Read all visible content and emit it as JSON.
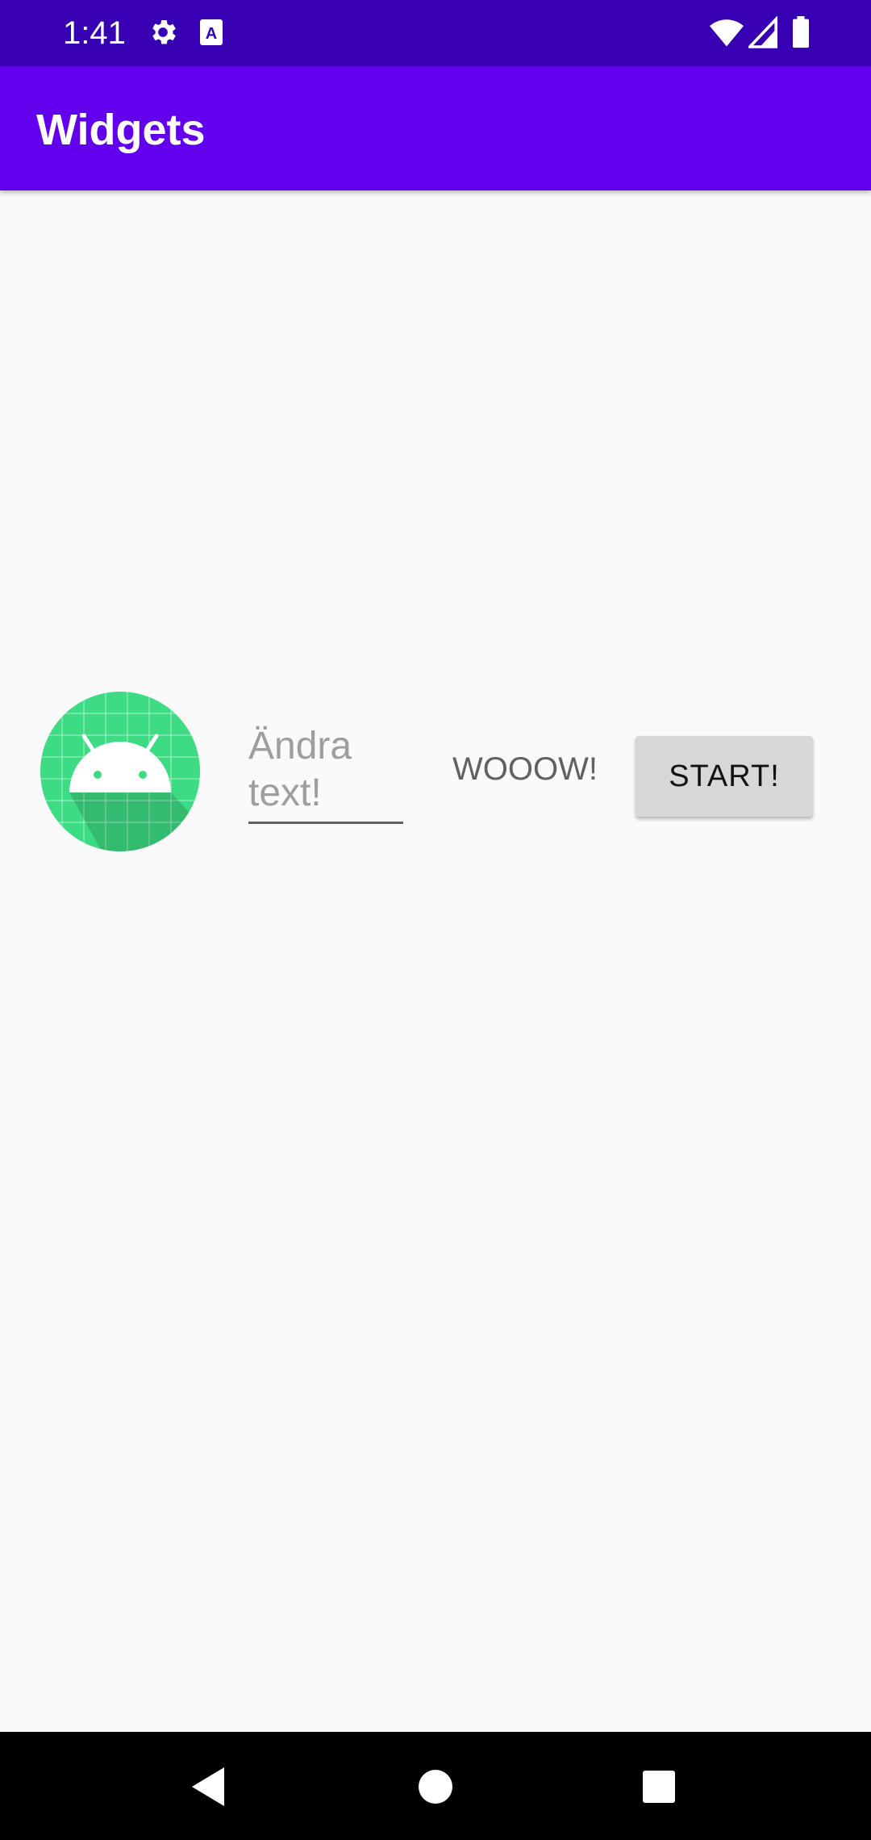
{
  "status_bar": {
    "time": "1:41",
    "icons": [
      "settings-gear-icon",
      "keyboard-a-icon",
      "wifi-icon",
      "cell-signal-icon",
      "battery-icon"
    ]
  },
  "app_bar": {
    "title": "Widgets",
    "color": "#6200ee",
    "status_color": "#3700b3"
  },
  "main": {
    "logo_icon": "android-logo-icon",
    "edit_text": {
      "value": "",
      "placeholder": "Ändra text!"
    },
    "label_text": "WOOOW!",
    "start_button_label": "START!"
  },
  "nav_bar": {
    "icons": [
      "back-triangle-icon",
      "home-circle-icon",
      "recents-square-icon"
    ]
  }
}
